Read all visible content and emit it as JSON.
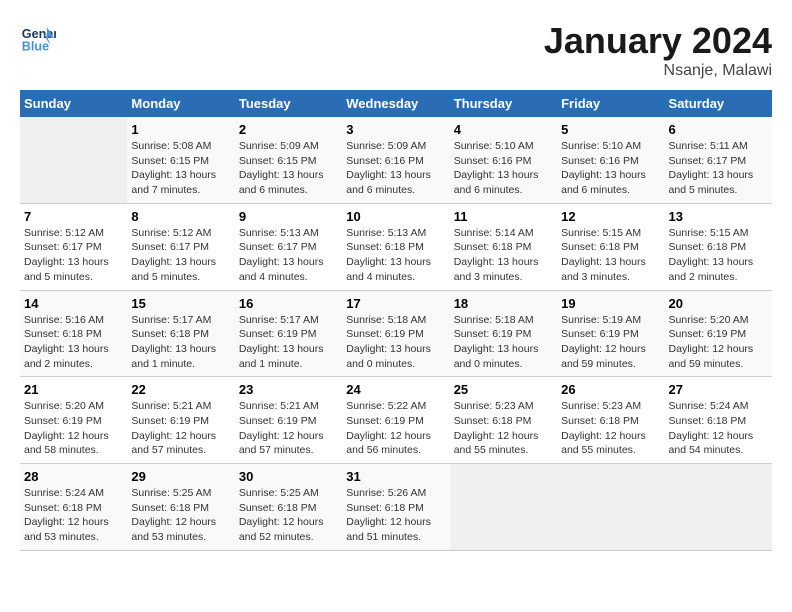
{
  "header": {
    "logo_line1": "General",
    "logo_line2": "Blue",
    "month_title": "January 2024",
    "location": "Nsanje, Malawi"
  },
  "weekdays": [
    "Sunday",
    "Monday",
    "Tuesday",
    "Wednesday",
    "Thursday",
    "Friday",
    "Saturday"
  ],
  "weeks": [
    [
      {
        "day": "",
        "empty": true
      },
      {
        "day": "1",
        "sunrise": "5:08 AM",
        "sunset": "6:15 PM",
        "daylight": "13 hours and 7 minutes."
      },
      {
        "day": "2",
        "sunrise": "5:09 AM",
        "sunset": "6:15 PM",
        "daylight": "13 hours and 6 minutes."
      },
      {
        "day": "3",
        "sunrise": "5:09 AM",
        "sunset": "6:16 PM",
        "daylight": "13 hours and 6 minutes."
      },
      {
        "day": "4",
        "sunrise": "5:10 AM",
        "sunset": "6:16 PM",
        "daylight": "13 hours and 6 minutes."
      },
      {
        "day": "5",
        "sunrise": "5:10 AM",
        "sunset": "6:16 PM",
        "daylight": "13 hours and 6 minutes."
      },
      {
        "day": "6",
        "sunrise": "5:11 AM",
        "sunset": "6:17 PM",
        "daylight": "13 hours and 5 minutes."
      }
    ],
    [
      {
        "day": "7",
        "sunrise": "5:12 AM",
        "sunset": "6:17 PM",
        "daylight": "13 hours and 5 minutes."
      },
      {
        "day": "8",
        "sunrise": "5:12 AM",
        "sunset": "6:17 PM",
        "daylight": "13 hours and 5 minutes."
      },
      {
        "day": "9",
        "sunrise": "5:13 AM",
        "sunset": "6:17 PM",
        "daylight": "13 hours and 4 minutes."
      },
      {
        "day": "10",
        "sunrise": "5:13 AM",
        "sunset": "6:18 PM",
        "daylight": "13 hours and 4 minutes."
      },
      {
        "day": "11",
        "sunrise": "5:14 AM",
        "sunset": "6:18 PM",
        "daylight": "13 hours and 3 minutes."
      },
      {
        "day": "12",
        "sunrise": "5:15 AM",
        "sunset": "6:18 PM",
        "daylight": "13 hours and 3 minutes."
      },
      {
        "day": "13",
        "sunrise": "5:15 AM",
        "sunset": "6:18 PM",
        "daylight": "13 hours and 2 minutes."
      }
    ],
    [
      {
        "day": "14",
        "sunrise": "5:16 AM",
        "sunset": "6:18 PM",
        "daylight": "13 hours and 2 minutes."
      },
      {
        "day": "15",
        "sunrise": "5:17 AM",
        "sunset": "6:18 PM",
        "daylight": "13 hours and 1 minute."
      },
      {
        "day": "16",
        "sunrise": "5:17 AM",
        "sunset": "6:19 PM",
        "daylight": "13 hours and 1 minute."
      },
      {
        "day": "17",
        "sunrise": "5:18 AM",
        "sunset": "6:19 PM",
        "daylight": "13 hours and 0 minutes."
      },
      {
        "day": "18",
        "sunrise": "5:18 AM",
        "sunset": "6:19 PM",
        "daylight": "13 hours and 0 minutes."
      },
      {
        "day": "19",
        "sunrise": "5:19 AM",
        "sunset": "6:19 PM",
        "daylight": "12 hours and 59 minutes."
      },
      {
        "day": "20",
        "sunrise": "5:20 AM",
        "sunset": "6:19 PM",
        "daylight": "12 hours and 59 minutes."
      }
    ],
    [
      {
        "day": "21",
        "sunrise": "5:20 AM",
        "sunset": "6:19 PM",
        "daylight": "12 hours and 58 minutes."
      },
      {
        "day": "22",
        "sunrise": "5:21 AM",
        "sunset": "6:19 PM",
        "daylight": "12 hours and 57 minutes."
      },
      {
        "day": "23",
        "sunrise": "5:21 AM",
        "sunset": "6:19 PM",
        "daylight": "12 hours and 57 minutes."
      },
      {
        "day": "24",
        "sunrise": "5:22 AM",
        "sunset": "6:19 PM",
        "daylight": "12 hours and 56 minutes."
      },
      {
        "day": "25",
        "sunrise": "5:23 AM",
        "sunset": "6:18 PM",
        "daylight": "12 hours and 55 minutes."
      },
      {
        "day": "26",
        "sunrise": "5:23 AM",
        "sunset": "6:18 PM",
        "daylight": "12 hours and 55 minutes."
      },
      {
        "day": "27",
        "sunrise": "5:24 AM",
        "sunset": "6:18 PM",
        "daylight": "12 hours and 54 minutes."
      }
    ],
    [
      {
        "day": "28",
        "sunrise": "5:24 AM",
        "sunset": "6:18 PM",
        "daylight": "12 hours and 53 minutes."
      },
      {
        "day": "29",
        "sunrise": "5:25 AM",
        "sunset": "6:18 PM",
        "daylight": "12 hours and 53 minutes."
      },
      {
        "day": "30",
        "sunrise": "5:25 AM",
        "sunset": "6:18 PM",
        "daylight": "12 hours and 52 minutes."
      },
      {
        "day": "31",
        "sunrise": "5:26 AM",
        "sunset": "6:18 PM",
        "daylight": "12 hours and 51 minutes."
      },
      {
        "day": "",
        "empty": true
      },
      {
        "day": "",
        "empty": true
      },
      {
        "day": "",
        "empty": true
      }
    ]
  ],
  "labels": {
    "sunrise_prefix": "Sunrise: ",
    "sunset_prefix": "Sunset: ",
    "daylight_prefix": "Daylight: "
  }
}
